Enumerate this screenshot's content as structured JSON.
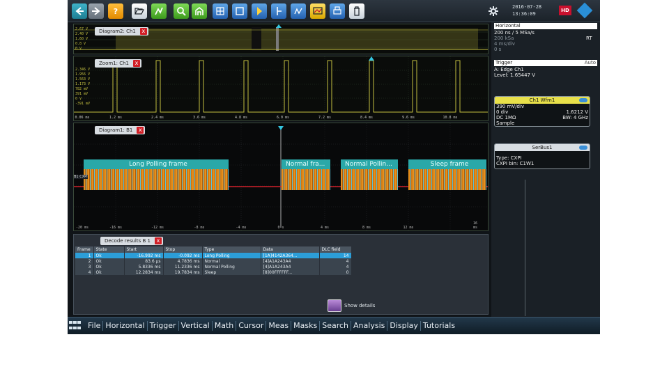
{
  "toolbar": {
    "buttons": [
      "back-icon",
      "forward-icon",
      "help-icon",
      "open-icon",
      "save-icon",
      "zoom-icon",
      "home-icon",
      "math-icon",
      "autoset-icon",
      "mark-icon",
      "cursor-icon",
      "mask-icon",
      "display-icon",
      "print-icon",
      "delete-icon",
      "settings-icon"
    ],
    "date": "2016-07-28",
    "time": "13:36:09",
    "hd_label": "HD"
  },
  "diagram2": {
    "title": "Diagram2: Ch1",
    "close": "x"
  },
  "zoom1": {
    "title": "Zoom1: Ch1",
    "close": "x",
    "ylabels": [
      "2.346 V",
      "1.956 V",
      "1.563 V",
      "1.173 V",
      "782 mV",
      "391 mV",
      "0 V",
      "-391 mV"
    ],
    "xticks": [
      "0.06 ms",
      "1.2 ms",
      "2.4 ms",
      "3.6 ms",
      "4.8 ms",
      "6.0 ms",
      "7.2 ms",
      "8.4 ms",
      "9.6 ms",
      "10.8 ms"
    ]
  },
  "diagram1": {
    "title": "Diagram1: B1",
    "close": "x",
    "bus_label": "B1 CXPI",
    "frames": [
      {
        "label": "Long Polling frame"
      },
      {
        "label": "Normal fra..."
      },
      {
        "label": "Normal Pollin..."
      },
      {
        "label": "Sleep frame"
      }
    ],
    "xticks": [
      "-20 ms",
      "-16 ms",
      "-12 ms",
      "-8 ms",
      "-4 ms",
      "0 s",
      "4 ms",
      "8 ms",
      "12 ms",
      "16 ms"
    ]
  },
  "decode": {
    "title": "Decode results B 1",
    "close": "x",
    "columns": [
      "Frame",
      "State",
      "Start",
      "Stop",
      "Type",
      "Data",
      "DLC field"
    ],
    "rows": [
      [
        "1",
        "Ok",
        "-16.992 ms",
        "-0.092 ms",
        "Long Polling",
        "[1A]4142A364...",
        "14"
      ],
      [
        "2",
        "Ok",
        "83.6 µs",
        "4.7836 ms",
        "Normal",
        "[4]A1A243A4",
        "4"
      ],
      [
        "3",
        "Ok",
        "5.8336 ms",
        "11.2336 ms",
        "Normal Polling",
        "[4]A1A243A4",
        "4"
      ],
      [
        "4",
        "Ok",
        "12.2834 ms",
        "19.7834 ms",
        "Sleep",
        "[8]00FFFFFF...",
        "0"
      ]
    ],
    "show_details": "Show details"
  },
  "right_panel": {
    "horizontal_header": "Horizontal",
    "h_line1": "200 ns / 5 MSa/s",
    "h_line2": "200 kSa",
    "h_line2_right": "RT",
    "h_line3": "4 ms/div",
    "h_line4": "0 s",
    "trigger_header": "Trigger",
    "trigger_mode": "Auto",
    "trigger_line1": "A:     Edge    Ch1",
    "trigger_line2": "Level: 1.65447 V",
    "ch1_card": {
      "title": "Ch1 Wfm1",
      "vdiv": "390 mV/div",
      "offset": "0 div",
      "offset_val": "1.6212 V",
      "coupling": "DC 1MΩ",
      "bw": "BW:  4 GHz",
      "mode": "Sample"
    },
    "serbus_card": {
      "title": "SerBus1",
      "type": "Type: CXPI",
      "bits": "CXPI bin: C1W1"
    }
  },
  "menubar": {
    "items": [
      "File",
      "Horizontal",
      "Trigger",
      "Vertical",
      "Math",
      "Cursor",
      "Meas",
      "Masks",
      "Search",
      "Analysis",
      "Display",
      "Tutorials"
    ]
  },
  "colors": {
    "ch1_yellow": "#c4bf40",
    "bus_teal": "#2aa8a8",
    "bus_orange": "#e8901a",
    "cursor_cyan": "#34c6e0",
    "selection_blue": "#2c9ed8",
    "red_trace": "#d0202a"
  }
}
